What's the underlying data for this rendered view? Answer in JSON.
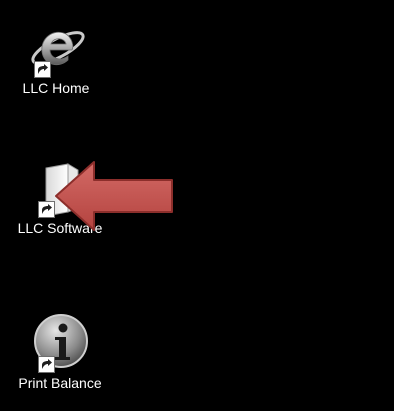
{
  "desktop": {
    "background": "#000000",
    "icons": [
      {
        "label": "LLC Home",
        "icon": "internet-explorer-icon",
        "shortcut": true
      },
      {
        "label": "LLC Software",
        "icon": "folder-document-icon",
        "shortcut": true
      },
      {
        "label": "Print Balance",
        "icon": "info-icon",
        "shortcut": true
      }
    ]
  },
  "annotation": {
    "type": "arrow",
    "direction": "left",
    "color": "#c0504d",
    "target": "LLC Software"
  }
}
